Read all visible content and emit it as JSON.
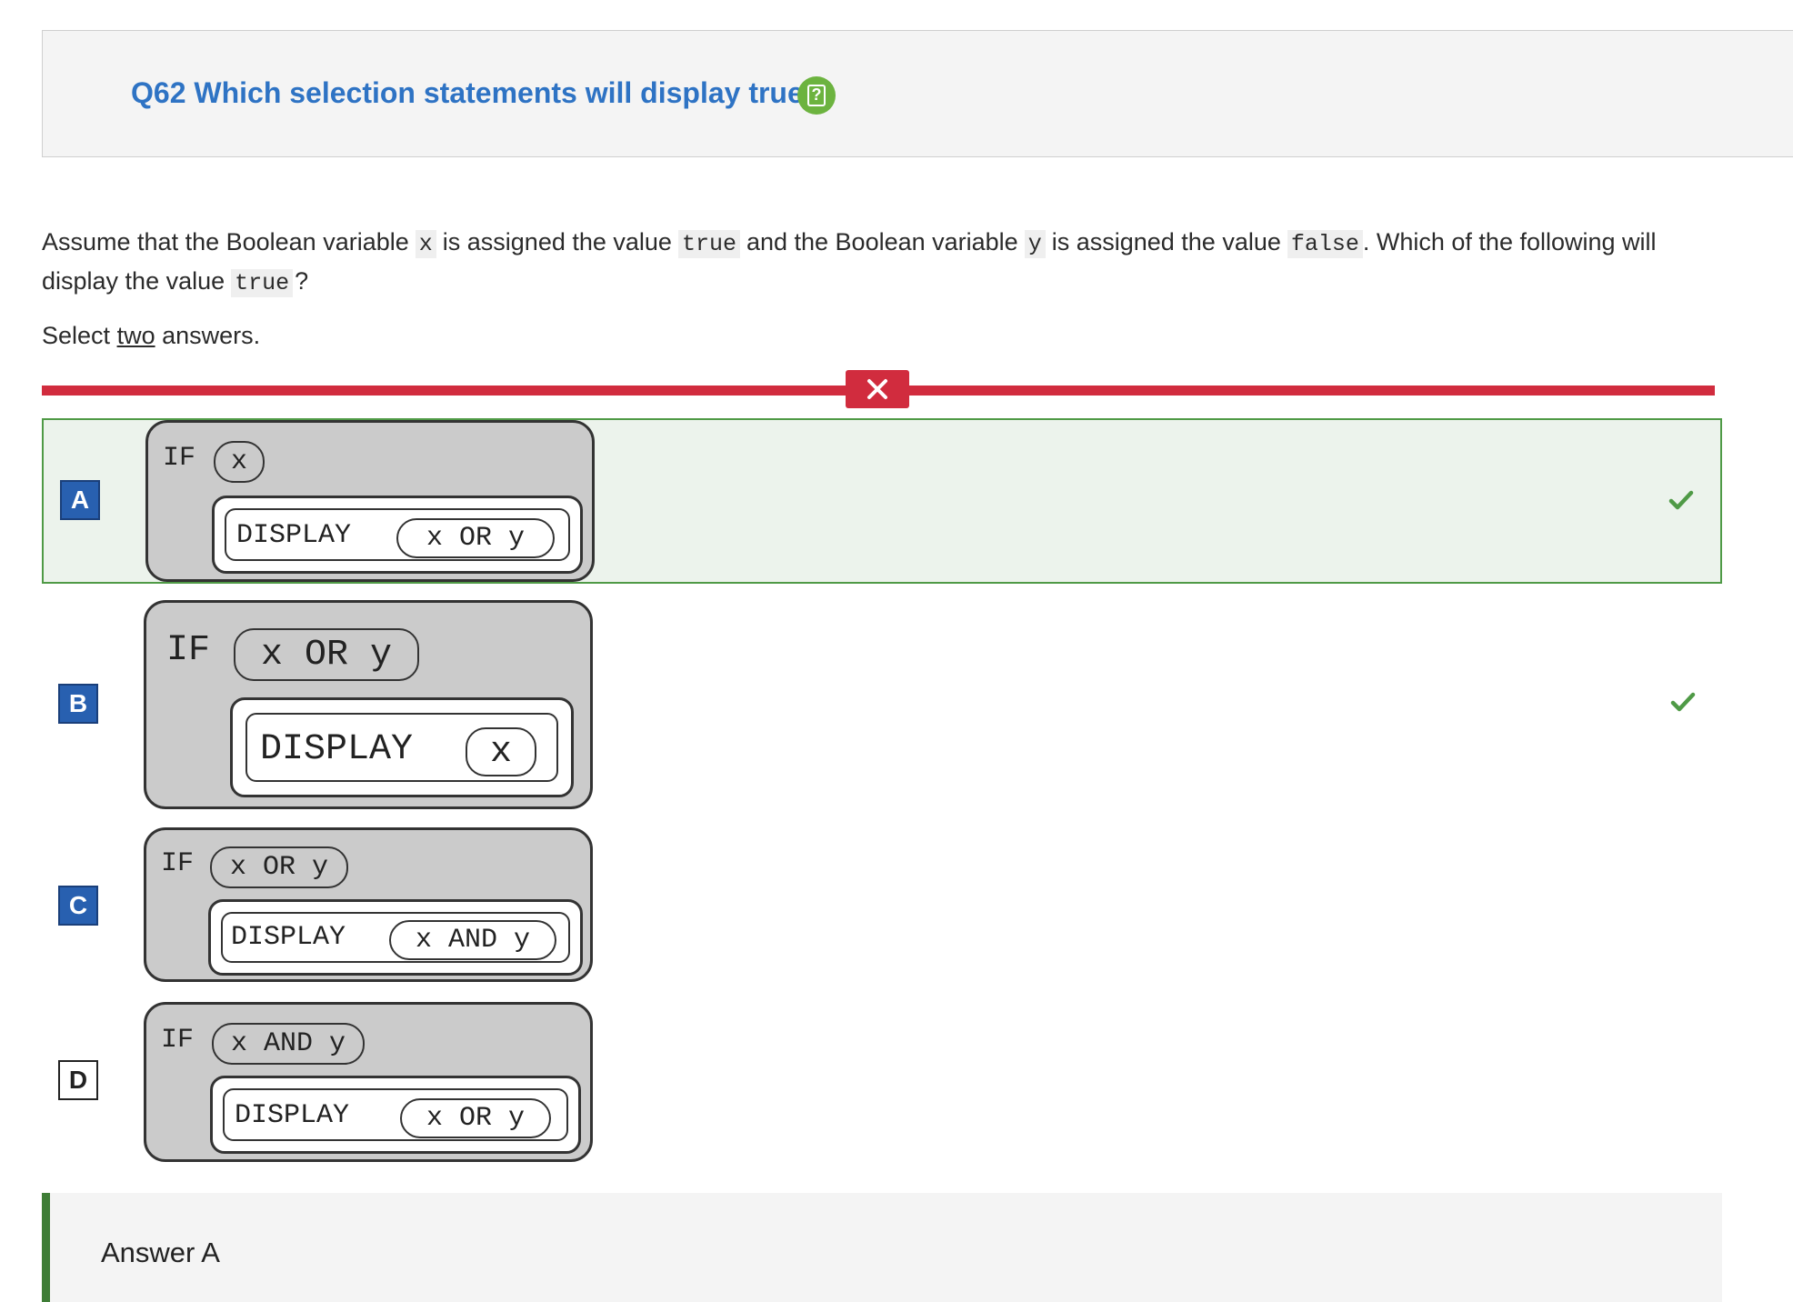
{
  "header": {
    "title": "Q62 Which selection statements will display true",
    "help_icon": "question-mark-icon",
    "help_icon_color": "#6cb33f"
  },
  "question": {
    "prompt_parts": [
      "Assume that the Boolean variable",
      "x",
      "is assigned the value",
      "true",
      "and the Boolean variable",
      "y",
      "is assigned the value",
      "false",
      ". Which of the following will display the value",
      "true",
      "?"
    ],
    "select_prefix": "Select",
    "select_count": "two",
    "select_suffix": "answers."
  },
  "result": {
    "status": "incorrect",
    "bar_color": "#d12c3e"
  },
  "options": [
    {
      "letter": "A",
      "if_keyword": "IF",
      "condition": "x",
      "display_keyword": "DISPLAY",
      "display_expr": "x OR y",
      "selected": true,
      "correct": true
    },
    {
      "letter": "B",
      "if_keyword": "IF",
      "condition": "x OR y",
      "display_keyword": "DISPLAY",
      "display_expr": "x",
      "selected": true,
      "correct": true
    },
    {
      "letter": "C",
      "if_keyword": "IF",
      "condition": "x OR y",
      "display_keyword": "DISPLAY",
      "display_expr": "x AND y",
      "selected": true,
      "correct": false
    },
    {
      "letter": "D",
      "if_keyword": "IF",
      "condition": "x AND y",
      "display_keyword": "DISPLAY",
      "display_expr": "x OR y",
      "selected": false,
      "correct": false
    }
  ],
  "answer": {
    "label": "Answer A"
  },
  "colors": {
    "accent": "#2e73c4",
    "correct": "#4f9a46",
    "incorrect": "#d12c3e",
    "selected_letter": "#2860b0"
  }
}
